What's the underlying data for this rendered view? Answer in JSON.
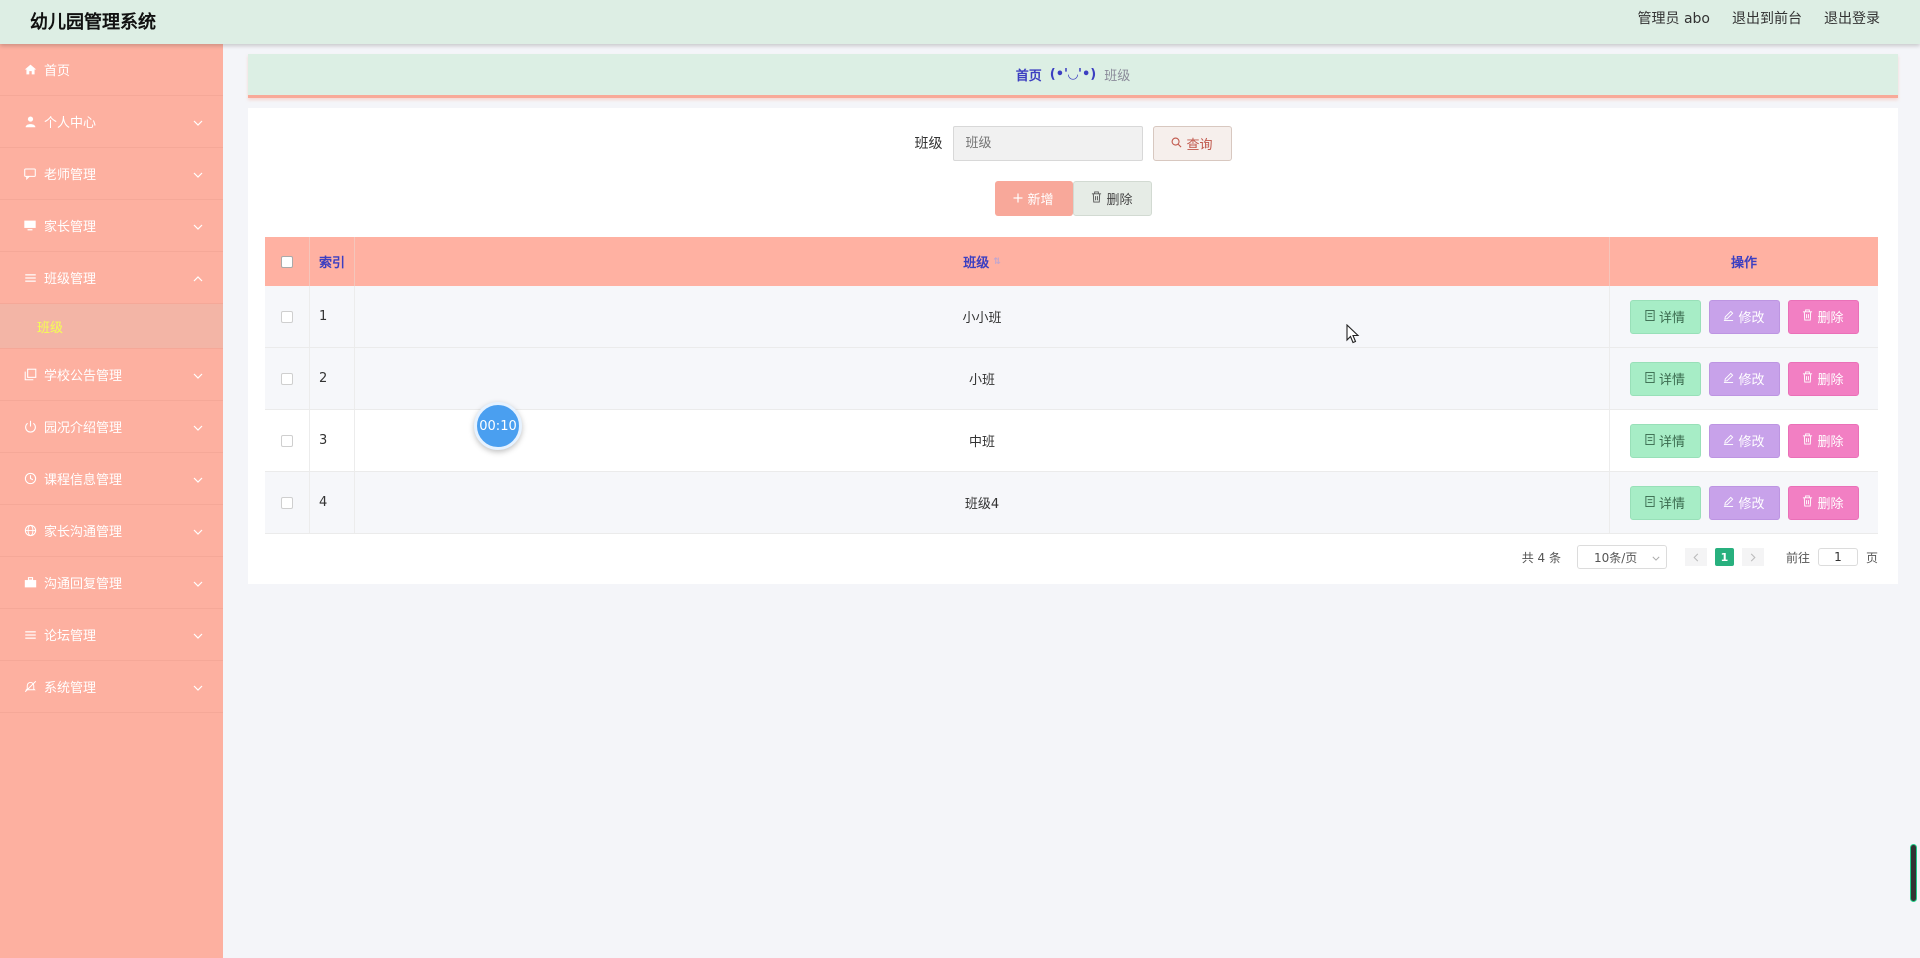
{
  "header": {
    "title": "幼儿园管理系统",
    "admin_label": "管理员 abo",
    "front_link": "退出到前台",
    "logout_link": "退出登录"
  },
  "sidebar": {
    "items": [
      {
        "label": "首页",
        "icon": "home-icon"
      },
      {
        "label": "个人中心",
        "icon": "user-icon"
      },
      {
        "label": "老师管理",
        "icon": "chat-icon"
      },
      {
        "label": "家长管理",
        "icon": "monitor-icon"
      },
      {
        "label": "班级管理",
        "icon": "list-icon"
      },
      {
        "label": "学校公告管理",
        "icon": "copy-icon"
      },
      {
        "label": "园况介绍管理",
        "icon": "power-icon"
      },
      {
        "label": "课程信息管理",
        "icon": "clock-icon"
      },
      {
        "label": "家长沟通管理",
        "icon": "globe-icon"
      },
      {
        "label": "沟通回复管理",
        "icon": "briefcase-icon"
      },
      {
        "label": "论坛管理",
        "icon": "list-icon"
      },
      {
        "label": "系统管理",
        "icon": "bell-off-icon"
      }
    ],
    "submenu_label": "班级"
  },
  "breadcrumb": {
    "home": "首页",
    "face": "(•'◡'•)",
    "current": "班级"
  },
  "search": {
    "label": "班级",
    "placeholder": "班级",
    "query_button": "查询"
  },
  "actions": {
    "add_button": "新增",
    "delete_button": "删除"
  },
  "table": {
    "headers": {
      "index": "索引",
      "name": "班级",
      "ops": "操作"
    },
    "rows": [
      {
        "index": "1",
        "name": "小小班"
      },
      {
        "index": "2",
        "name": "小班"
      },
      {
        "index": "3",
        "name": "中班"
      },
      {
        "index": "4",
        "name": "班级4"
      }
    ],
    "op_labels": {
      "detail": "详情",
      "edit": "修改",
      "delete": "删除"
    }
  },
  "pagination": {
    "total": "共 4 条",
    "page_size": "10条/页",
    "current_page": "1",
    "goto_prefix": "前往",
    "goto_value": "1",
    "goto_suffix": "页"
  },
  "timer": {
    "text": "00:10"
  },
  "colors": {
    "sidebar": "#fdb0a0",
    "header": "#ddeee4",
    "accent": "#3c3fc1",
    "page_active": "#28b07e"
  }
}
